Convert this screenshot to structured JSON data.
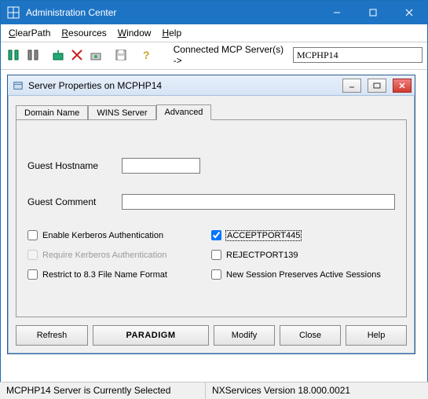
{
  "window": {
    "title": "Administration Center"
  },
  "menu": {
    "clearpath": "ClearPath",
    "resources": "Resources",
    "window": "Window",
    "help": "Help"
  },
  "toolbar": {
    "connected_label": "Connected MCP Server(s) ->",
    "server_value": "MCPHP14"
  },
  "child": {
    "title": "Server Properties on MCPHP14",
    "tabs": {
      "domain": "Domain Name",
      "wins": "WINS Server",
      "advanced": "Advanced"
    },
    "fields": {
      "guest_hostname_label": "Guest Hostname",
      "guest_hostname_value": "",
      "guest_comment_label": "Guest Comment",
      "guest_comment_value": ""
    },
    "checks_left": {
      "enable_kerberos": "Enable Kerberos Authentication",
      "require_kerberos": "Require Kerberos Authentication",
      "restrict_83": "Restrict to 8.3 File Name Format"
    },
    "checks_right": {
      "accept445": "ACCEPTPORT445",
      "reject139": "REJECTPORT139",
      "preserve_sessions": "New Session Preserves Active Sessions"
    },
    "buttons": {
      "refresh": "Refresh",
      "paradigm": "PARADIGM",
      "modify": "Modify",
      "close": "Close",
      "help": "Help"
    }
  },
  "status": {
    "left": "MCPHP14 Server is Currently Selected",
    "right": "NXServices Version 18.000.0021"
  }
}
